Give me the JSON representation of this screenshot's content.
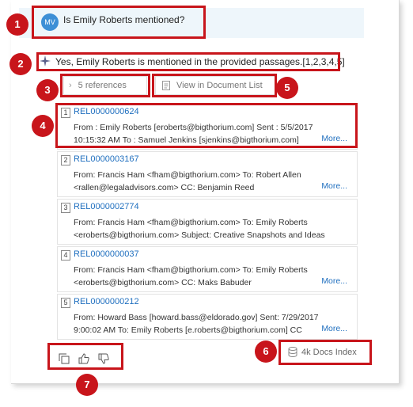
{
  "query": {
    "avatar_initials": "MV",
    "text": "Is Emily Roberts mentioned?"
  },
  "answer": {
    "text": "Yes, Emily Roberts is mentioned in the provided passages.[1,2,3,4,5]"
  },
  "toolbar": {
    "references_label": "5 references",
    "view_label": "View in Document List"
  },
  "references": [
    {
      "num": "1",
      "id": "REL0000000624",
      "line1": "From : Emily Roberts [eroberts@bigthorium.com] Sent : 5/5/2017",
      "line2": "10:15:32 AM To : Samuel Jenkins [sjenkins@bigthorium.com]",
      "more": "More..."
    },
    {
      "num": "2",
      "id": "REL0000003167",
      "line1": "From: Francis Ham <fham@bigthorium.com> To: Robert Allen",
      "line2": "<rallen@legaladvisors.com> CC: Benjamin Reed",
      "more": "More..."
    },
    {
      "num": "3",
      "id": "REL0000002774",
      "line1": "From: Francis Ham <fham@bigthorium.com> To: Emily Roberts",
      "line2": "<eroberts@bigthorium.com> Subject: Creative Snapshots and Ideas",
      "more": ""
    },
    {
      "num": "4",
      "id": "REL0000000037",
      "line1": "From: Francis Ham <fham@bigthorium.com> To: Emily Roberts",
      "line2": "<eroberts@bigthorium.com> CC: Maks Babuder",
      "more": "More..."
    },
    {
      "num": "5",
      "id": "REL0000000212",
      "line1": "From: Howard Bass [howard.bass@eldorado.gov] Sent: 7/29/2017",
      "line2": "9:00:02 AM To: Emily Roberts [e.roberts@bigthorium.com] CC",
      "more": "More..."
    }
  ],
  "index": {
    "label": "4k Docs Index"
  },
  "callouts": [
    "1",
    "2",
    "3",
    "4",
    "5",
    "6",
    "7"
  ],
  "colors": {
    "callout": "#c8151b",
    "link": "#1f6fbf",
    "query_bg": "#eef6fb",
    "avatar": "#3d8fd6"
  }
}
